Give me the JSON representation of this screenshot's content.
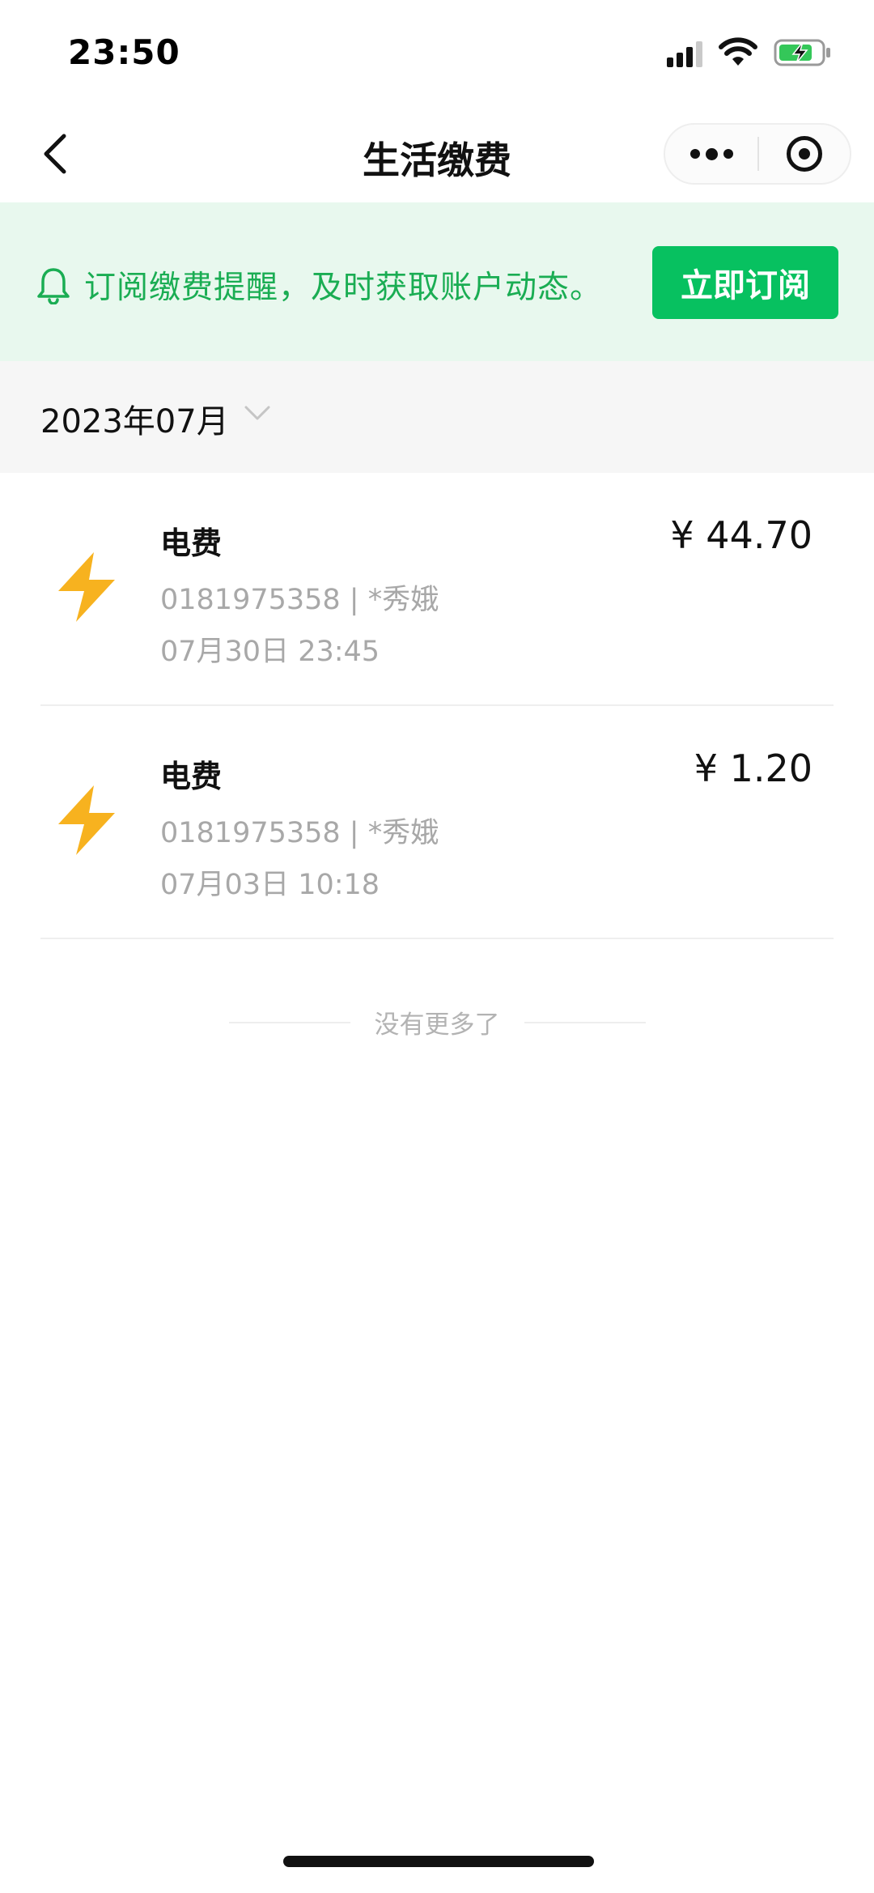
{
  "status_bar": {
    "time": "23:50",
    "signal_icon": "signal-icon",
    "wifi_icon": "wifi-icon",
    "battery_icon": "battery-charging-icon"
  },
  "nav": {
    "title": "生活缴费",
    "back_icon": "chevron-left-icon",
    "more_icon": "more-dots-icon",
    "close_icon": "target-circle-icon"
  },
  "banner": {
    "icon": "bell-icon",
    "text": "订阅缴费提醒，及时获取账户动态。",
    "button_label": "立即订阅",
    "text_color": "#1aad53",
    "button_color": "#07c160",
    "background": "#e8f8ee"
  },
  "month_filter": {
    "label": "2023年07月",
    "chevron_icon": "chevron-down-icon"
  },
  "records": [
    {
      "icon": "lightning-icon",
      "title": "电费",
      "amount": "¥ 44.70",
      "account": "0181975358 | *秀娥",
      "time": "07月30日   23:45"
    },
    {
      "icon": "lightning-icon",
      "title": "电费",
      "amount": "¥ 1.20",
      "account": "0181975358 | *秀娥",
      "time": "07月03日   10:18"
    }
  ],
  "end_text": "没有更多了",
  "colors": {
    "lightning": "#f7b21f",
    "accent": "#07c160",
    "muted_text": "#a8a8a8"
  }
}
